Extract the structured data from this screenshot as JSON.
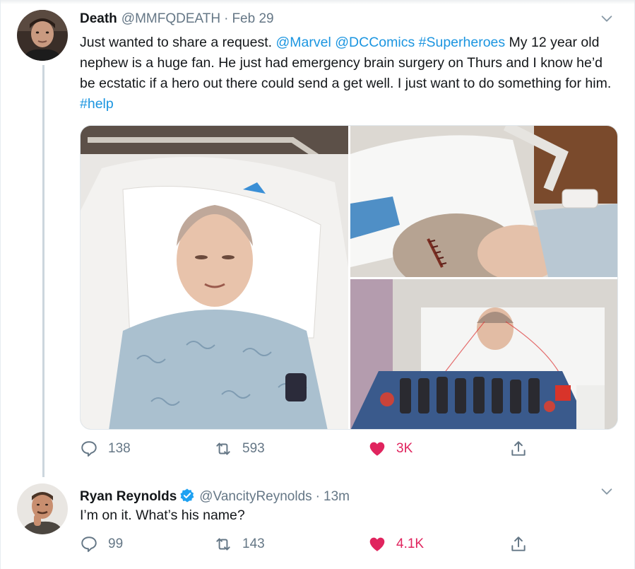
{
  "tweet1": {
    "name": "Death",
    "handle": "@MMFQDEATH",
    "separator": "·",
    "time": "Feb 29",
    "text_before": "Just wanted to share a request. ",
    "mention1": "@Marvel",
    "space1": " ",
    "mention2": "@DCComics",
    "space2": " ",
    "hashtag1": "#Superheroes",
    "text_middle": " My 12 year old nephew is a huge fan. He just had emergency brain surgery on Thurs and I know he’d be ecstatic if a hero out there could send a get well. I just want to do something for him. ",
    "hashtag2": "#help",
    "replies": "138",
    "retweets": "593",
    "likes": "3K"
  },
  "tweet2": {
    "name": "Ryan Reynolds",
    "handle": "@VancityReynolds",
    "separator": "·",
    "time": "13m",
    "text": "I’m on it. What’s his name?",
    "replies": "99",
    "retweets": "143",
    "likes": "4.1K"
  },
  "icons": {
    "reply": "speech-bubble-icon",
    "retweet": "retweet-arrows-icon",
    "like": "heart-icon",
    "share": "share-upload-icon",
    "caret": "chevron-down-icon",
    "verified": "verified-badge-icon"
  },
  "colors": {
    "link": "#1b95e0",
    "like": "#e0245e",
    "muted": "#657786",
    "verified": "#1da1f2"
  }
}
